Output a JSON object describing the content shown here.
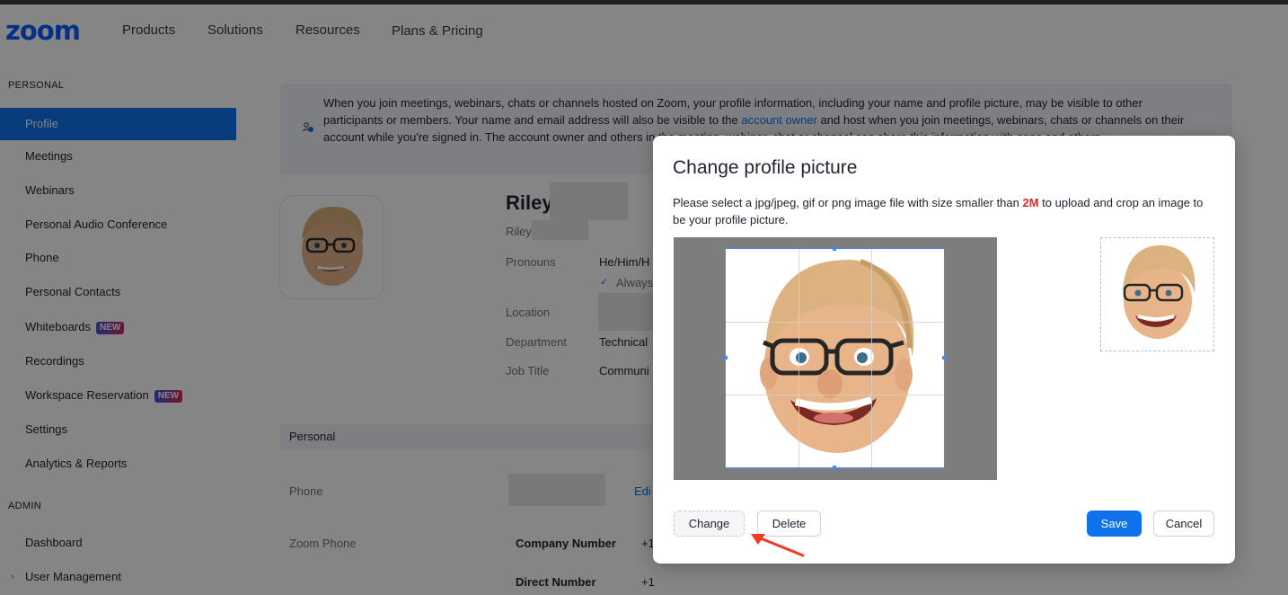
{
  "brand": {
    "logo": "zoom",
    "color": "#0b5cff"
  },
  "topnav": {
    "items": [
      "Products",
      "Solutions",
      "Resources",
      "Plans & Pricing"
    ]
  },
  "sidebar": {
    "personal_heading": "PERSONAL",
    "items": [
      {
        "label": "Profile",
        "active": true
      },
      {
        "label": "Meetings"
      },
      {
        "label": "Webinars"
      },
      {
        "label": "Personal Audio Conference"
      },
      {
        "label": "Phone"
      },
      {
        "label": "Personal Contacts"
      },
      {
        "label": "Whiteboards",
        "badge": "NEW"
      },
      {
        "label": "Recordings"
      },
      {
        "label": "Workspace Reservation",
        "badge": "NEW"
      },
      {
        "label": "Settings"
      },
      {
        "label": "Analytics & Reports"
      }
    ],
    "admin_heading": "ADMIN",
    "admin_items": [
      {
        "label": "Dashboard"
      },
      {
        "label": "User Management",
        "icon": "chevron-right-icon"
      }
    ]
  },
  "notice": {
    "text_before": "When you join meetings, webinars, chats or channels hosted on Zoom, your profile information, including your name and profile picture, may be visible to other participants or members. Your name and email address will also be visible to the ",
    "link": "account owner",
    "text_after": " and host when you join meetings, webinars, chats or channels on their account while you're signed in. The account owner and others in the meeting, webinar, chat or channel can share this information with apps and others."
  },
  "profile": {
    "name": "Riley",
    "subname": "Riley",
    "fields": [
      {
        "label": "Pronouns",
        "value": "He/Him/H"
      },
      {
        "label": "Location",
        "value": ""
      },
      {
        "label": "Department",
        "value": "Technical"
      },
      {
        "label": "Job Title",
        "value": "Communi"
      }
    ],
    "pronoun_option": "Always"
  },
  "personal_section": {
    "heading": "Personal",
    "phone_label": "Phone",
    "edit_label": "Edi",
    "zoom_phone_label": "Zoom Phone",
    "company_number_label": "Company Number",
    "company_number_value": "+1",
    "direct_number_label": "Direct Number",
    "direct_number_value": "+1"
  },
  "modal": {
    "title": "Change profile picture",
    "desc_before": "Please select a jpg/jpeg, gif or png image file with size smaller than ",
    "desc_limit": "2M",
    "desc_after": " to upload and crop an image to be your profile picture.",
    "buttons": {
      "change": "Change",
      "delete": "Delete",
      "save": "Save",
      "cancel": "Cancel"
    },
    "accent_color": "#0e72ed",
    "annotation_arrow_color": "#ee3b24"
  }
}
